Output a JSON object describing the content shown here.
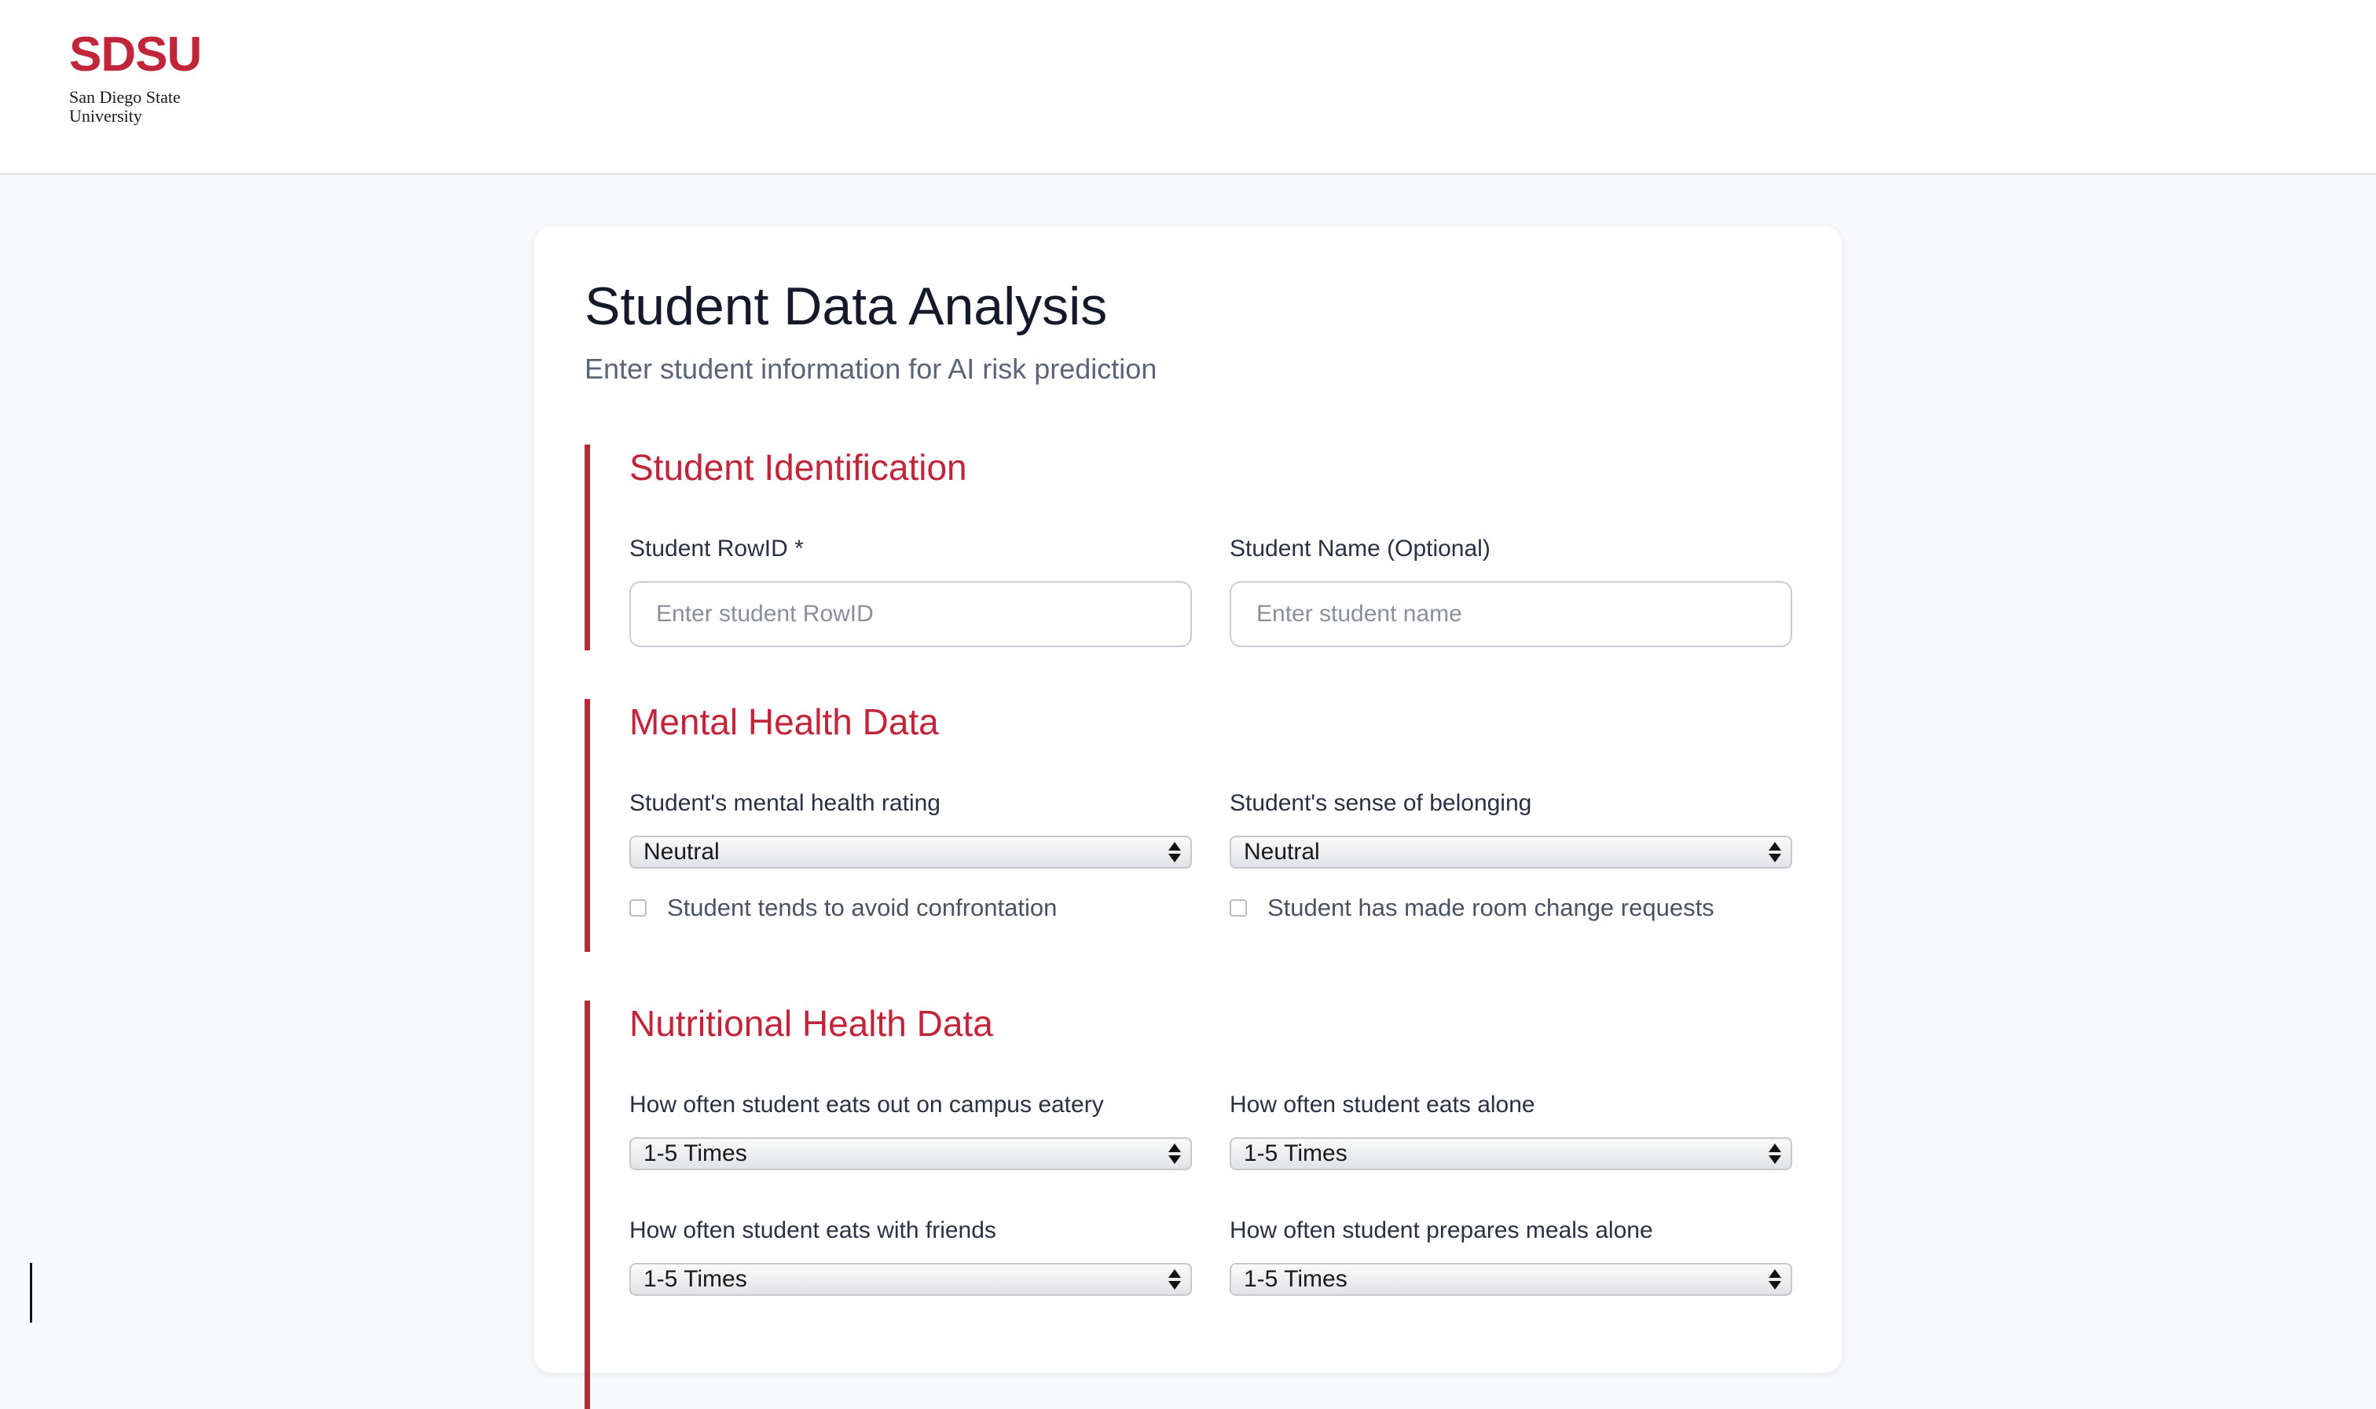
{
  "brand": {
    "mark": "SDSU",
    "name_line1": "San Diego State",
    "name_line2": "University",
    "accent_color": "#c0253a"
  },
  "page": {
    "title": "Student Data Analysis",
    "subtitle": "Enter student information for AI risk prediction"
  },
  "identification": {
    "title": "Student Identification",
    "rowid_label": "Student RowID *",
    "rowid_placeholder": "Enter student RowID",
    "name_label": "Student Name (Optional)",
    "name_placeholder": "Enter student name"
  },
  "mental_health": {
    "title": "Mental Health Data",
    "rating_label": "Student's mental health rating",
    "rating_value": "Neutral",
    "belonging_label": "Student's sense of belonging",
    "belonging_value": "Neutral",
    "confrontation_label": "Student tends to avoid confrontation",
    "room_change_label": "Student has made room change requests"
  },
  "nutrition": {
    "title": "Nutritional Health Data",
    "eats_out_label": "How often student eats out on campus eatery",
    "eats_out_value": "1-5 Times",
    "eats_alone_label": "How often student eats alone",
    "eats_alone_value": "1-5 Times",
    "eats_friends_label": "How often student eats with friends",
    "eats_friends_value": "1-5 Times",
    "prepares_alone_label": "How often student prepares meals alone",
    "prepares_alone_value": "1-5 Times"
  }
}
